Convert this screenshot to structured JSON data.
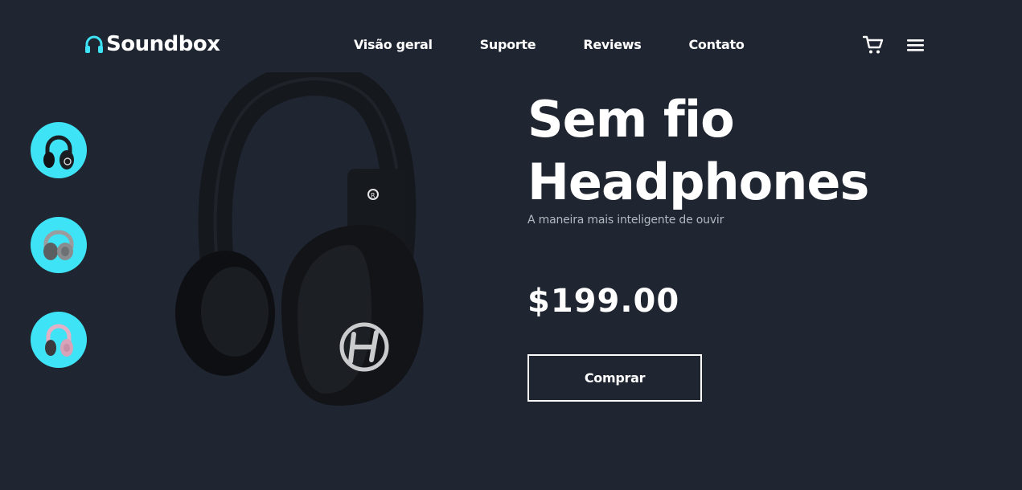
{
  "brand": {
    "name": "Soundbox",
    "icon": "headphones-icon",
    "accent": "#3ee3f5"
  },
  "nav": {
    "items": [
      {
        "label": "Visão geral"
      },
      {
        "label": "Suporte"
      },
      {
        "label": "Reviews"
      },
      {
        "label": "Contato"
      }
    ]
  },
  "header_icons": {
    "cart": "cart-icon",
    "menu": "menu-icon"
  },
  "thumbnails": [
    {
      "name": "black-headphones",
      "color": "#1a1d22"
    },
    {
      "name": "gray-headphones",
      "color": "#8a8d8f"
    },
    {
      "name": "pink-headphones",
      "color": "#d6a3b9"
    }
  ],
  "hero": {
    "title_line1": "Sem fio",
    "title_line2": "Headphones",
    "subtitle": "A maneira mais inteligente de ouvir",
    "price": "$199.00",
    "buy_label": "Comprar"
  },
  "colors": {
    "background": "#1f2531",
    "text": "#ffffff",
    "muted": "#b4b8c0"
  }
}
